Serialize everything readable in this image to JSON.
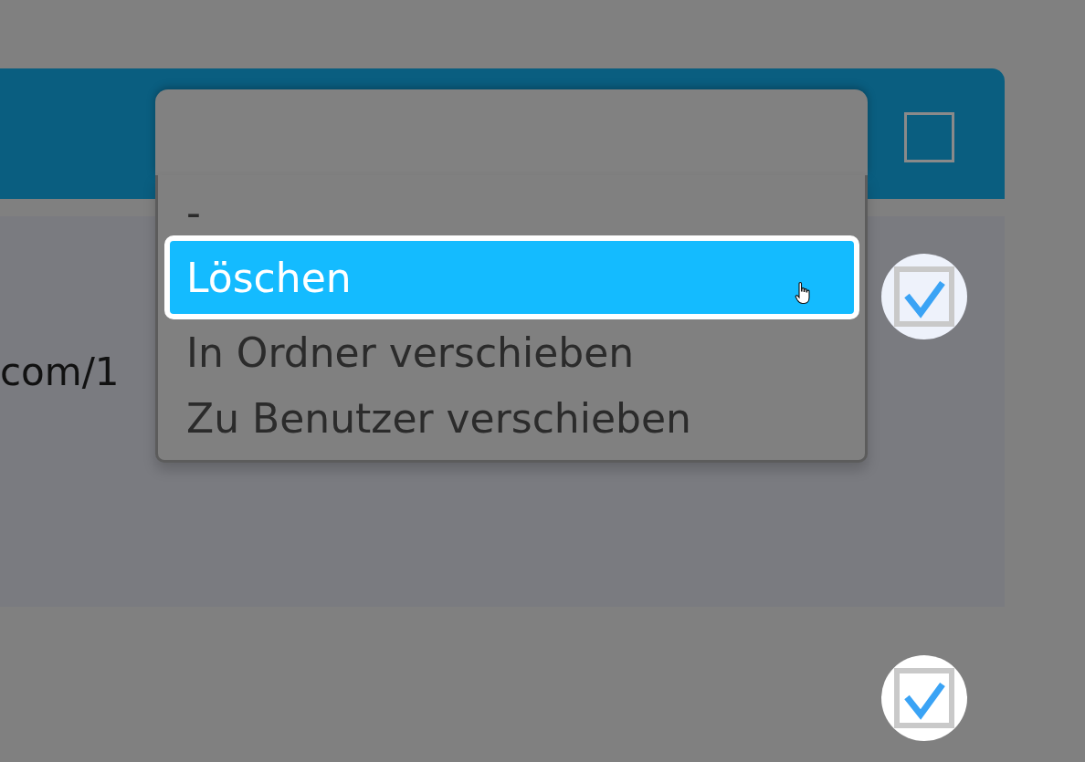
{
  "header": {
    "checked": false
  },
  "action_menu": {
    "options": [
      {
        "label": "-",
        "selected": false
      },
      {
        "label": "Löschen",
        "selected": true
      },
      {
        "label": "In Ordner verschieben",
        "selected": false
      },
      {
        "label": "Zu Benutzer verschieben",
        "selected": false
      }
    ]
  },
  "rows": [
    {
      "text": "com/1",
      "checked": true,
      "highlighted": true
    },
    {
      "checked": true,
      "highlighted": false
    }
  ]
}
